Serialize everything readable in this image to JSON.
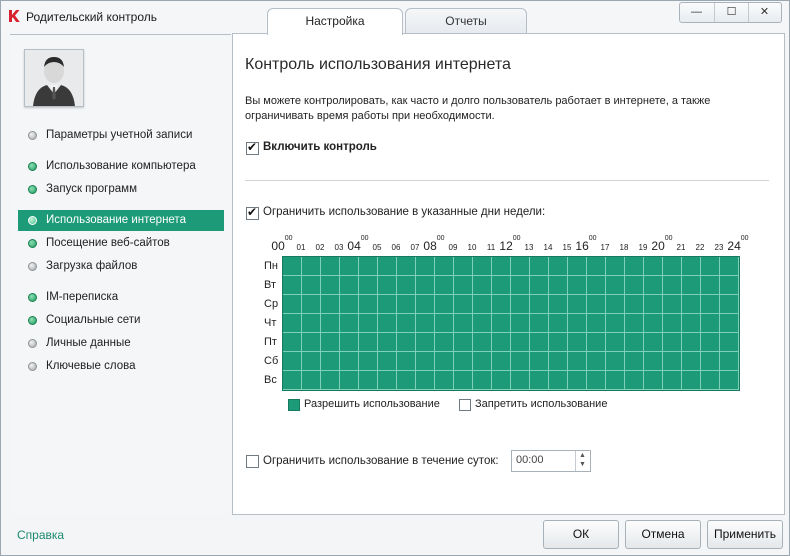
{
  "window": {
    "title": "Родительский контроль",
    "tabs": [
      {
        "label": "Настройка",
        "active": true
      },
      {
        "label": "Отчеты",
        "active": false
      }
    ],
    "controls": {
      "minimize": "—",
      "maximize": "☐",
      "close": "✕"
    }
  },
  "sidebar": {
    "items": [
      {
        "label": "Параметры учетной записи",
        "status": "gray",
        "active": false
      },
      {
        "label": "Использование компьютера",
        "status": "green",
        "active": false
      },
      {
        "label": "Запуск программ",
        "status": "green",
        "active": false
      },
      {
        "label": "Использование интернета",
        "status": "green",
        "active": true
      },
      {
        "label": "Посещение веб-сайтов",
        "status": "green",
        "active": false
      },
      {
        "label": "Загрузка файлов",
        "status": "gray",
        "active": false
      },
      {
        "label": "IM-переписка",
        "status": "green",
        "active": false
      },
      {
        "label": "Социальные сети",
        "status": "green",
        "active": false
      },
      {
        "label": "Личные данные",
        "status": "gray",
        "active": false
      },
      {
        "label": "Ключевые слова",
        "status": "gray",
        "active": false
      }
    ]
  },
  "main": {
    "title": "Контроль использования интернета",
    "description": "Вы можете контролировать, как часто и долго пользователь работает в интернете, а также ограничивать время работы при необходимости.",
    "enable_control": {
      "label": "Включить контроль",
      "checked": true
    },
    "limit_days": {
      "label": "Ограничить использование в указанные дни недели:",
      "checked": true
    },
    "schedule": {
      "hours": [
        "00",
        "01",
        "02",
        "03",
        "04",
        "05",
        "06",
        "07",
        "08",
        "09",
        "10",
        "11",
        "12",
        "13",
        "14",
        "15",
        "16",
        "17",
        "18",
        "19",
        "20",
        "21",
        "22",
        "23",
        "24"
      ],
      "major_sup": "00",
      "days": [
        "Пн",
        "Вт",
        "Ср",
        "Чт",
        "Пт",
        "Сб",
        "Вс"
      ],
      "all_allowed": true
    },
    "legend": {
      "allow": "Разрешить использование",
      "deny": "Запретить использование"
    },
    "limit_daily": {
      "label": "Ограничить использование в течение суток:",
      "checked": false,
      "value": "00:00"
    }
  },
  "footer": {
    "help": "Справка",
    "ok": "ОК",
    "cancel": "Отмена",
    "apply": "Применить"
  },
  "colors": {
    "accent": "#1d9a78",
    "help_link": "#1d8a6e"
  }
}
